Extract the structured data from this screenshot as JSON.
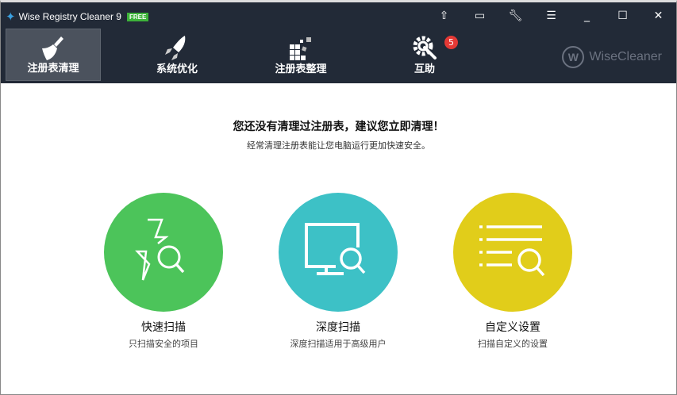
{
  "window": {
    "title": "Wise Registry Cleaner 9",
    "edition_badge": "FREE"
  },
  "titlebar_buttons": [
    "upgrade",
    "feedback",
    "settings",
    "menu",
    "minimize",
    "maximize",
    "close"
  ],
  "nav": [
    {
      "label": "注册表清理",
      "icon": "broom-icon",
      "active": true
    },
    {
      "label": "系统优化",
      "icon": "rocket-icon"
    },
    {
      "label": "注册表整理",
      "icon": "blocks-icon"
    },
    {
      "label": "互助",
      "icon": "gear-wrench-icon",
      "badge": "5"
    }
  ],
  "brand": {
    "logo_letter": "W",
    "name": "WiseCleaner"
  },
  "main": {
    "headline": "您还没有清理过注册表，建议您立即清理！",
    "subtitle": "经常清理注册表能让您电脑运行更加快速安全。"
  },
  "scans": [
    {
      "title": "快速扫描",
      "desc": "只扫描安全的项目",
      "color": "#4cc45a"
    },
    {
      "title": "深度扫描",
      "desc": "深度扫描适用于高级用户",
      "color": "#3dc1c6"
    },
    {
      "title": "自定义设置",
      "desc": "扫描自定义的设置",
      "color": "#e1cd1a"
    }
  ]
}
